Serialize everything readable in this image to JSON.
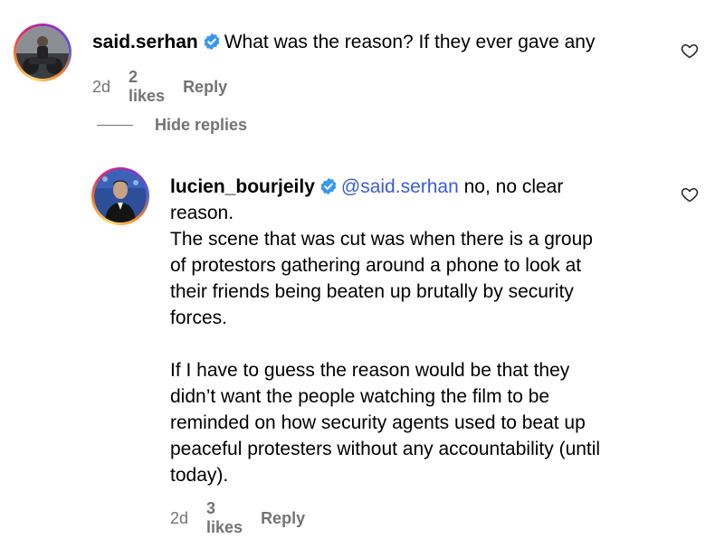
{
  "comments": [
    {
      "username": "said.serhan",
      "verified": true,
      "text": "What was the reason? If they ever gave any",
      "time": "2d",
      "likes": "2 likes",
      "reply_label": "Reply"
    },
    {
      "username": "lucien_bourjeily",
      "verified": true,
      "mention": "@said.serhan",
      "text": " no, no clear\nreason.\nThe scene that was cut was when there is a group\nof protestors gathering around a phone to look at\ntheir friends being beaten up brutally by security\nforces.\n\nIf I have to guess the reason would be that they\ndidn’t want the people watching the film to be\nreminded on how security agents used to beat up\npeaceful protesters without any accountability (until\ntoday).",
      "time": "2d",
      "likes": "3 likes",
      "reply_label": "Reply"
    }
  ],
  "replies_toggle": {
    "label": "Hide replies"
  },
  "colors": {
    "verified_blue": "#3897f0",
    "mention_blue": "#3b5bdb",
    "meta_gray": "#737373"
  },
  "icons": {
    "verified": "verified-badge-icon",
    "like": "heart-outline-icon"
  }
}
